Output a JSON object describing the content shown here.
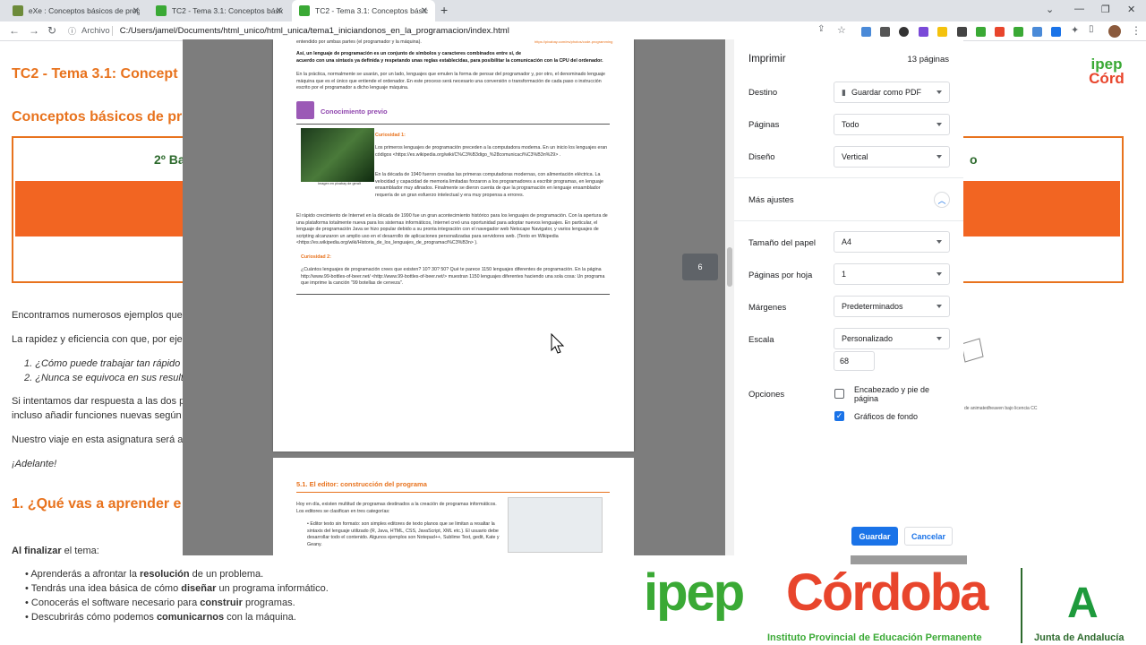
{
  "browser": {
    "tabs": [
      {
        "title": "eXe : Conceptos básicos de prog"
      },
      {
        "title": "TC2 - Tema 3.1: Conceptos básic"
      },
      {
        "title": "TC2 - Tema 3.1: Conceptos básic"
      }
    ],
    "address_info": "Archivo",
    "address_url": "C:/Users/jamel/Documents/html_unico/html_unica/tema1_iniciandonos_en_la_programacion/index.html"
  },
  "background_page": {
    "title": "TC2 - Tema 3.1: Concept",
    "subtitle": "Conceptos básicos de pr",
    "box_left": "2º Ba",
    "box_right": "o",
    "logo_top": "ipep",
    "logo_bottom": "Córd",
    "p1": "Encontramos numerosos ejemplos que",
    "p2": "La rapidez y eficiencia con que, por eje",
    "li1": "1. ¿Cómo puede trabajar tan rápido",
    "li2": "2. ¿Nunca se equivoca en sus result",
    "p3a": "Si intentamos dar respuesta a las dos p",
    "p3b": "incluso añadir funciones nuevas según",
    "p4": "Nuestro viaje en esta asignatura será a",
    "p5": "¡Adelante!",
    "section_heading": "1. ¿Qué vas a aprender e",
    "learn_intro_bold": "Al finalizar",
    "learn_intro_rest": " el tema:",
    "bullets": [
      {
        "pre": "Aprenderás a afrontar la ",
        "bold": "resolución",
        "post": " de un problema."
      },
      {
        "pre": "Tendrás una idea básica de cómo ",
        "bold": "diseñar",
        "post": " un programa informático."
      },
      {
        "pre": "Conocerás el software necesario para ",
        "bold": "construir",
        "post": " programas."
      },
      {
        "pre": "Descubrirás cómo podemos ",
        "bold": "comunicarnos",
        "post": " con la máquina."
      }
    ],
    "credit": "de animatedheaven bajo licencia CC"
  },
  "print_preview": {
    "top_lines": [
      "entendido por ambas partes (el programador y la máquina).",
      "Así, un lenguaje de programación es un conjunto de símbolos y caracteres combinados entre sí, de",
      "acuerdo con una sintaxis ya definida y respetando unas reglas establecidas, para posibilitar la comunicación con la CPU del ordenador."
    ],
    "para_practice": "En la práctica, normalmente se usarán, por un lado, lenguajes que emulen la forma de pensar del programador y, por otro, el denominado lenguaje máquina que es el único que entiende el ordenador. En este proceso será necesario una conversión o transformación de cada paso o instrucción escrito por el programador a dicho lenguaje máquina.",
    "prev_heading": "Conocimiento previo",
    "curio1": "Curiosidad 1:",
    "curio1_text": "Los primeros lenguajes de programación preceden a la computadora moderna. En un inicio los lenguajes eran códigos <https://es.wikipedia.org/wiki/C%C3%B3digo_%28comunicaci%C3%B3n%29> .",
    "curio1_text2": "En la década de 1940 fueron creadas las primeras computadoras modernas, con alimentación eléctrica. La velocidad y capacidad de memoria limitadas forzaron a los programadores a escribir programas, en lenguaje ensamblador muy afinados. Finalmente se dieron cuenta de que la programación en lenguaje ensamblador requería de un gran esfuerzo intelectual y era muy propensa a errores.",
    "img_caption": "Imagen en pixabay de geralt",
    "para_internet": "El rápido crecimiento de Internet en la década de 1990 fue un gran acontecimiento histórico para los lenguajes de programación. Con la apertura de una plataforma totalmente nueva para los sistemas informáticos, Internet creó una oportunidad para adoptar nuevos lenguajes. En particular, el lenguaje de programación Java se hizo popular debido a su pronta integración con el navegador web Netscape Navigator, y varios lenguajes de scripting alcanzaron un amplio uso en el desarrollo de aplicaciones personalizadas para servidores web. (Texto en Wikipedia <https://es.wikipedia.org/wiki/Historia_de_los_lenguajes_de_programaci%C3%B3n> ).",
    "curio2": "Curiosidad 2:",
    "curio2_text": "¿Cuántos lenguajes de programación crees que existen? 10? 30? 50? Qué te parece 1150 lenguajes diferentes de programación. En la página http://www.99-bottles-of-beer.net/ <http://www.99-bottles-of-beer.net/> muestran 1150 lenguajes diferentes haciendo una sola cosa: Un programa que imprime la canción \"99 botellas de cerveza\".",
    "page_b_heading": "5.1. El editor: construcción del programa",
    "page_b_intro": "Hoy en día, existen multitud de programas destinados a la creación de programas informáticos. Los editores se clasifican en tres categorías:",
    "page_b_bullet": "Editor texto sin formato: son simples editores de texto planos que se limitan a resaltar la sintaxis del lenguaje utilizado (R, Java, HTML, CSS, JavaScript, XML etc.). El usuario debe desarrollar todo el contenido. Algunos ejemplos son Notepad++, Sublime Text, gedit, Kate y Geany.",
    "page_number": "6"
  },
  "print_panel": {
    "title": "Imprimir",
    "pages_count": "13 páginas",
    "rows": {
      "destino_label": "Destino",
      "destino_value": "Guardar como PDF",
      "paginas_label": "Páginas",
      "paginas_value": "Todo",
      "diseno_label": "Diseño",
      "diseno_value": "Vertical",
      "mas_ajustes": "Más ajustes",
      "tamano_label": "Tamaño del papel",
      "tamano_value": "A4",
      "ppp_label": "Páginas por hoja",
      "ppp_value": "1",
      "margenes_label": "Márgenes",
      "margenes_value": "Predeterminados",
      "escala_label": "Escala",
      "escala_value": "Personalizado",
      "escala_num": "68",
      "opciones_label": "Opciones",
      "opt1": "Encabezado y pie de página",
      "opt2": "Gráficos de fondo"
    },
    "save": "Guardar",
    "cancel": "Cancelar"
  },
  "banner": {
    "ipep": "ipep",
    "cordoba": "Córdoba",
    "institute": "Instituto Provincial de Educación Permanente",
    "junta": "Junta de Andalucía"
  },
  "colors": {
    "accent": "#e8731e",
    "orange_bar": "#f26522",
    "green": "#3aa935",
    "blue": "#1a73e8"
  }
}
